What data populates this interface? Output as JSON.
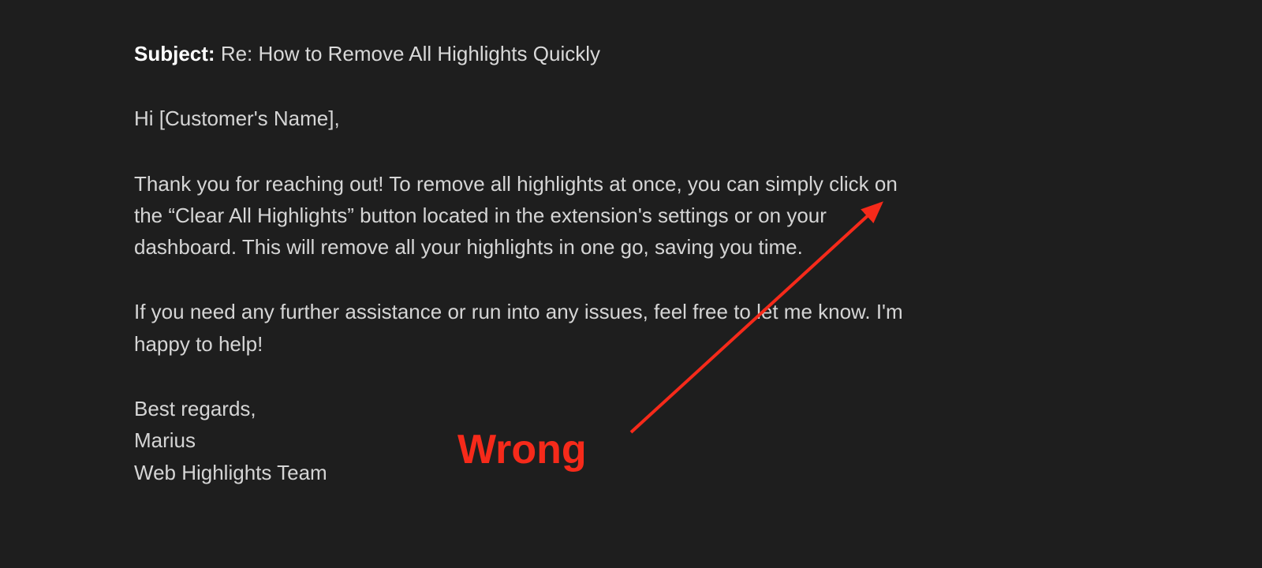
{
  "subject": {
    "label": "Subject:",
    "text": "Re: How to Remove All Highlights Quickly"
  },
  "body": {
    "greeting": "Hi [Customer's Name],",
    "para1": "Thank you for reaching out! To remove all highlights at once, you can simply click on the “Clear All Highlights” button located in the extension's settings or on your dashboard. This will remove all your highlights in one go, saving you time.",
    "para2": "If you need any further assistance or run into any issues, feel free to let me know. I'm happy to help!",
    "closing": "Best regards,",
    "name": "Marius",
    "team": "Web Highlights Team"
  },
  "annotation": {
    "label": "Wrong",
    "color": "#f62a1a"
  }
}
